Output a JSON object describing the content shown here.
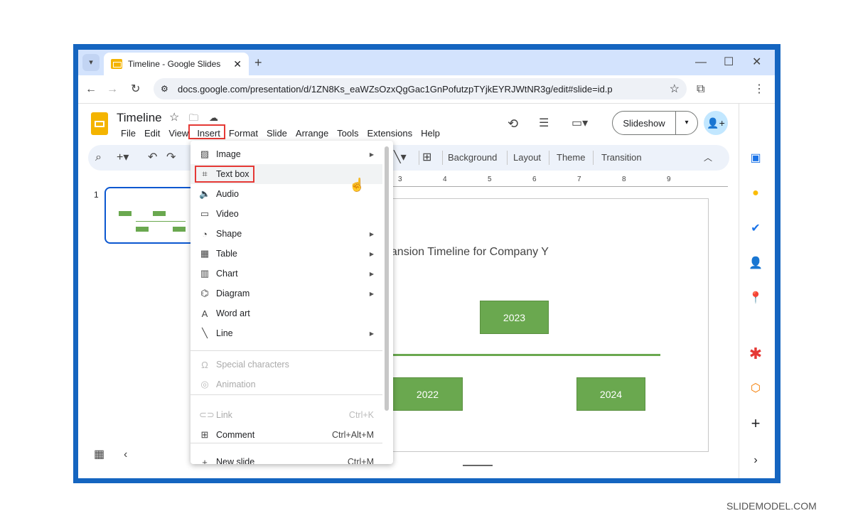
{
  "browser": {
    "tab_title": "Timeline - Google Slides",
    "url": "docs.google.com/presentation/d/1ZN8Ks_eaWZsOzxQgGac1GnPofutzpTYjkEYRJWtNR3g/edit#slide=id.p"
  },
  "doc": {
    "title": "Timeline",
    "menus": [
      "File",
      "Edit",
      "View",
      "Insert",
      "Format",
      "Slide",
      "Arrange",
      "Tools",
      "Extensions",
      "Help"
    ],
    "slideshow": "Slideshow"
  },
  "toolbar": {
    "background": "Background",
    "layout": "Layout",
    "theme": "Theme",
    "transition": "Transition"
  },
  "insert_menu": {
    "items": [
      {
        "label": "Image",
        "icon": "image-icon",
        "submenu": true
      },
      {
        "label": "Text box",
        "icon": "text-box-icon",
        "highlighted": true
      },
      {
        "label": "Audio",
        "icon": "audio-icon"
      },
      {
        "label": "Video",
        "icon": "video-icon"
      },
      {
        "label": "Shape",
        "icon": "shape-icon",
        "submenu": true
      },
      {
        "label": "Table",
        "icon": "table-icon",
        "submenu": true
      },
      {
        "label": "Chart",
        "icon": "chart-icon",
        "submenu": true
      },
      {
        "label": "Diagram",
        "icon": "diagram-icon",
        "submenu": true
      },
      {
        "label": "Word art",
        "icon": "word-art-icon"
      },
      {
        "label": "Line",
        "icon": "line-icon",
        "submenu": true
      },
      {
        "label": "Special characters",
        "icon": "omega-icon",
        "disabled": true
      },
      {
        "label": "Animation",
        "icon": "animation-icon",
        "disabled": true
      },
      {
        "label": "Link",
        "icon": "link-icon",
        "disabled": true,
        "shortcut": "Ctrl+K"
      },
      {
        "label": "Comment",
        "icon": "comment-icon",
        "shortcut": "Ctrl+Alt+M"
      },
      {
        "label": "New slide",
        "icon": "new-slide-icon",
        "shortcut": "Ctrl+M"
      }
    ]
  },
  "ruler": [
    "3",
    "4",
    "5",
    "6",
    "7",
    "8",
    "9"
  ],
  "filmstrip": {
    "slide_number": "1"
  },
  "slide": {
    "title": "Expansion Timeline for Company Y",
    "visible_title": "pansion Timeline for Company Y",
    "years": [
      "2022",
      "2023",
      "2024"
    ]
  },
  "colors": {
    "frame": "#1565c0",
    "box": "#6aa84f",
    "highlight": "#e53935"
  },
  "watermark": "SLIDEMODEL.COM"
}
